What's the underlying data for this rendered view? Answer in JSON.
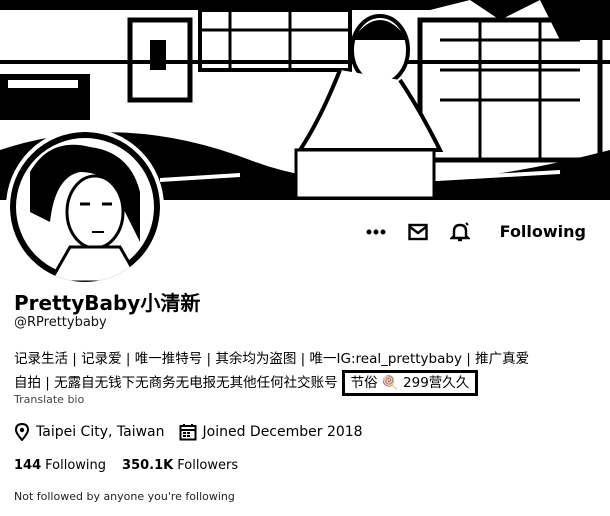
{
  "profile": {
    "display_name": "PrettyBaby小清新",
    "handle": "@RPrettybaby",
    "bio_line1": "记录生活 | 记录爱 | 唯一推特号 | 其余均为盗图 | 唯一IG:real_prettybaby | 推广真爱",
    "bio_line2_prefix": "自拍 | 无露自无钱下无商务无电报无其他任何社交账号",
    "bio_highlight": "节俗 🍭 299营久久",
    "translate_label": "Translate bio",
    "location": "Taipei City, Taiwan",
    "joined": "Joined December 2018",
    "following_count": "144",
    "following_label": "Following",
    "followers_count": "350.1K",
    "followers_label": "Followers",
    "not_followed_text": "Not followed by anyone you're following"
  },
  "actions": {
    "follow_button_label": "Following",
    "icons": [
      "more-icon",
      "message-icon",
      "notification-bell-icon"
    ]
  },
  "colors": {
    "text": "#000000",
    "background": "#ffffff"
  }
}
